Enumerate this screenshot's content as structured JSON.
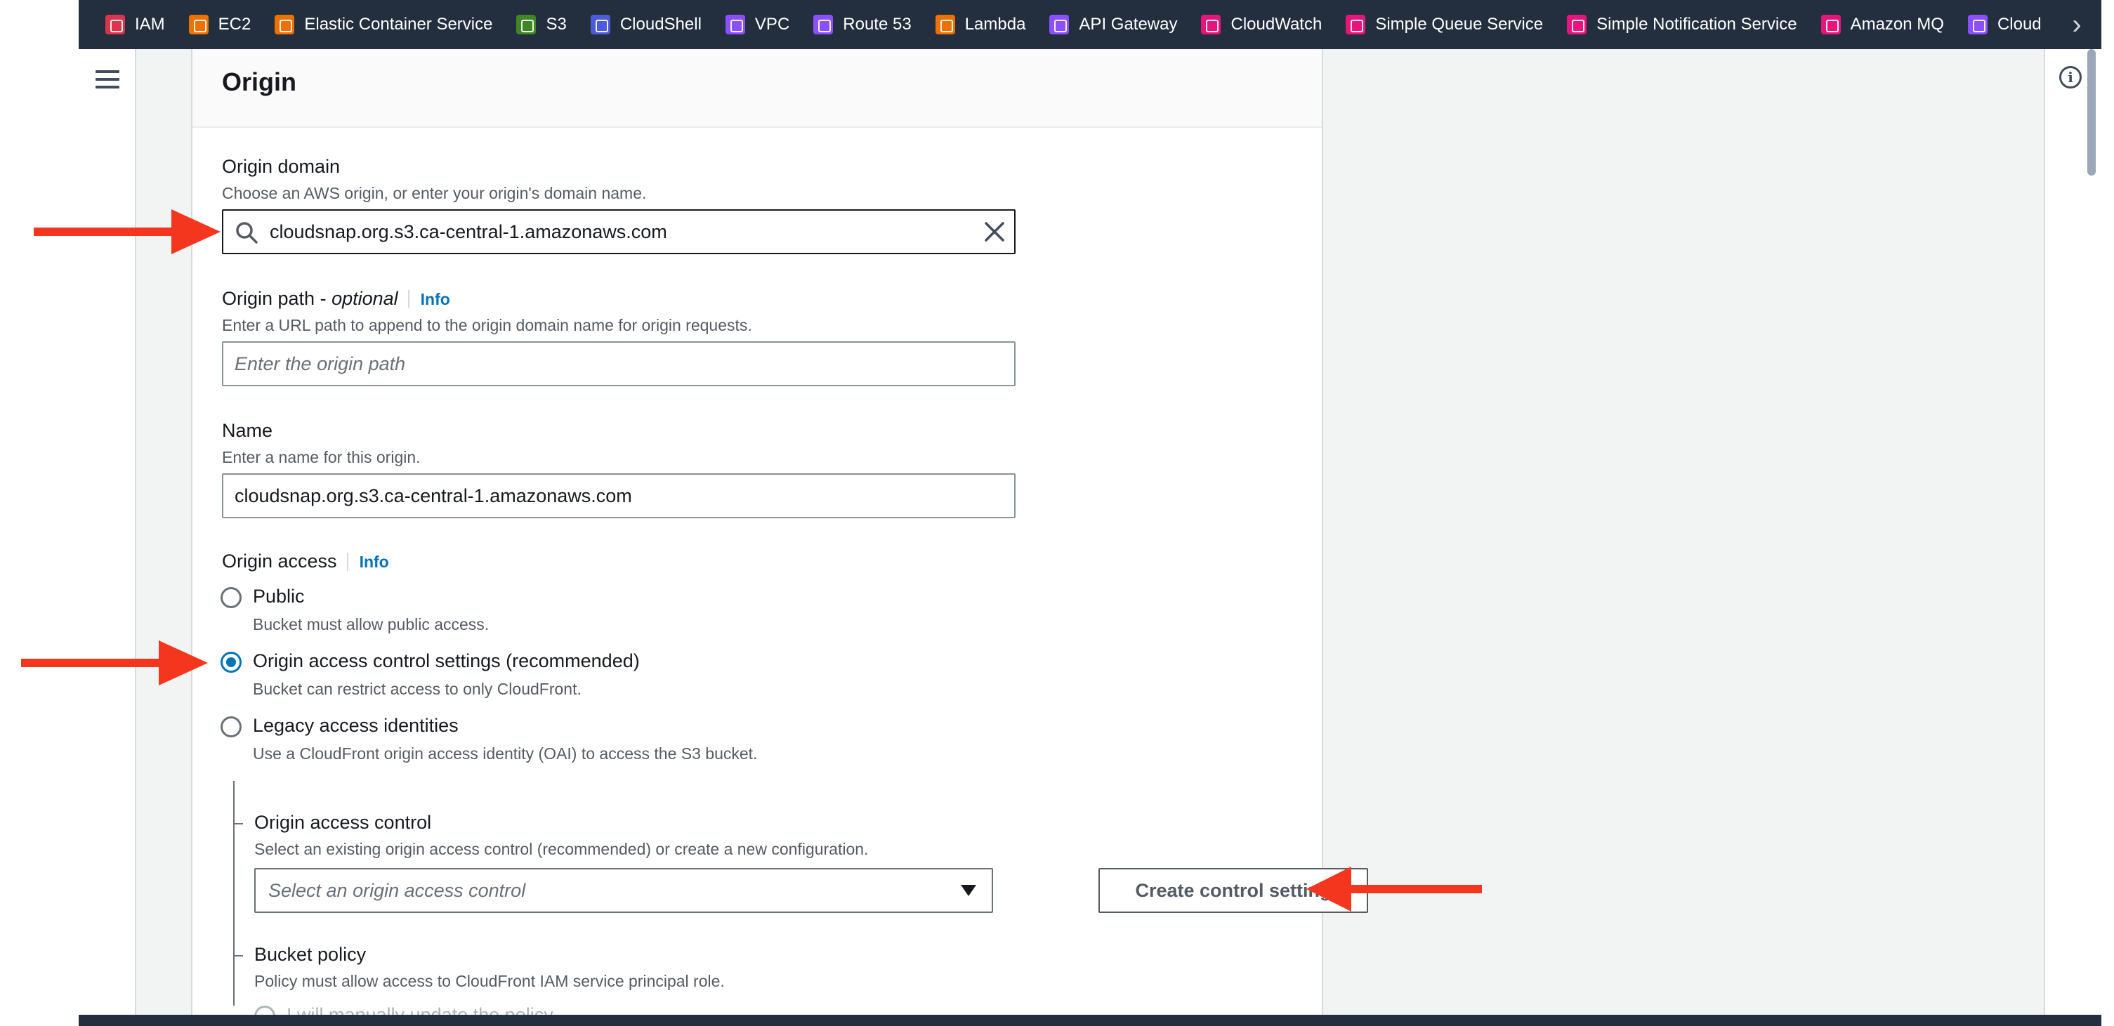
{
  "favorites": [
    {
      "label": "IAM",
      "color": "#dd344c",
      "icon": "iam-icon"
    },
    {
      "label": "EC2",
      "color": "#ed7100",
      "icon": "ec2-icon"
    },
    {
      "label": "Elastic Container Service",
      "color": "#ed7100",
      "icon": "ecs-icon"
    },
    {
      "label": "S3",
      "color": "#3f8624",
      "icon": "s3-icon"
    },
    {
      "label": "CloudShell",
      "color": "#4d5bd6",
      "icon": "cloudshell-icon"
    },
    {
      "label": "VPC",
      "color": "#8c4fff",
      "icon": "vpc-icon"
    },
    {
      "label": "Route 53",
      "color": "#8c4fff",
      "icon": "route53-icon"
    },
    {
      "label": "Lambda",
      "color": "#ed7100",
      "icon": "lambda-icon"
    },
    {
      "label": "API Gateway",
      "color": "#8c4fff",
      "icon": "api-gateway-icon"
    },
    {
      "label": "CloudWatch",
      "color": "#e7157b",
      "icon": "cloudwatch-icon"
    },
    {
      "label": "Simple Queue Service",
      "color": "#e7157b",
      "icon": "sqs-icon"
    },
    {
      "label": "Simple Notification Service",
      "color": "#e7157b",
      "icon": "sns-icon"
    },
    {
      "label": "Amazon MQ",
      "color": "#e7157b",
      "icon": "amazon-mq-icon"
    },
    {
      "label": "Cloud",
      "color": "#8c4fff",
      "icon": "cloud-service-icon"
    }
  ],
  "panel": {
    "title": "Origin"
  },
  "origin_domain": {
    "label": "Origin domain",
    "description": "Choose an AWS origin, or enter your origin's domain name.",
    "value": "cloudsnap.org.s3.ca-central-1.amazonaws.com"
  },
  "origin_path": {
    "label": "Origin path - ",
    "label_optional": "optional",
    "info": "Info",
    "description": "Enter a URL path to append to the origin domain name for origin requests.",
    "placeholder": "Enter the origin path"
  },
  "name": {
    "label": "Name",
    "description": "Enter a name for this origin.",
    "value": "cloudsnap.org.s3.ca-central-1.amazonaws.com"
  },
  "origin_access": {
    "label": "Origin access",
    "info": "Info",
    "options": [
      {
        "label": "Public",
        "description": "Bucket must allow public access.",
        "selected": false
      },
      {
        "label": "Origin access control settings (recommended)",
        "description": "Bucket can restrict access to only CloudFront.",
        "selected": true
      },
      {
        "label": "Legacy access identities",
        "description": "Use a CloudFront origin access identity (OAI) to access the S3 bucket.",
        "selected": false
      }
    ]
  },
  "origin_access_control": {
    "label": "Origin access control",
    "description": "Select an existing origin access control (recommended) or create a new configuration.",
    "placeholder": "Select an origin access control",
    "create_button": "Create control setting"
  },
  "bucket_policy": {
    "label": "Bucket policy",
    "description": "Policy must allow access to CloudFront IAM service principal role.",
    "option_partial": "I will manually update the policy"
  },
  "colors": {
    "annotation_arrow": "#f4361e",
    "link": "#0073bb",
    "nav_bg": "#232f3e"
  }
}
